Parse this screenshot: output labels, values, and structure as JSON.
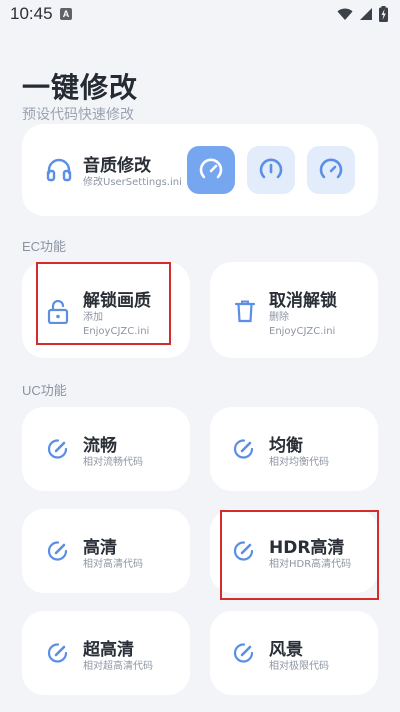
{
  "status_bar": {
    "time": "10:45",
    "notification_badge": "A",
    "icons": [
      "wifi-icon",
      "signal-icon",
      "battery-charging-icon"
    ]
  },
  "header": {
    "title": "一键修改",
    "subtitle": "预设代码快速修改"
  },
  "sound_quality": {
    "title": "音质修改",
    "description": "修改UserSettings.ini",
    "icon": "headphones-icon",
    "options": [
      {
        "icon": "gauge-high-icon",
        "selected": true
      },
      {
        "icon": "gauge-mid-icon",
        "selected": false
      },
      {
        "icon": "gauge-low-icon",
        "selected": false
      }
    ]
  },
  "ec_section": {
    "label": "EC功能",
    "items": [
      {
        "title": "解锁画质",
        "desc_line1": "添加",
        "desc_line2": "EnjoyCJZC.ini",
        "icon": "unlock-icon"
      },
      {
        "title": "取消解锁",
        "desc_line1": "删除",
        "desc_line2": "EnjoyCJZC.ini",
        "icon": "trash-icon"
      }
    ]
  },
  "uc_section": {
    "label": "UC功能",
    "items": [
      {
        "title": "流畅",
        "desc": "相对流畅代码",
        "icon": "edit-icon"
      },
      {
        "title": "均衡",
        "desc": "相对均衡代码",
        "icon": "edit-icon"
      },
      {
        "title": "高清",
        "desc": "相对高清代码",
        "icon": "edit-icon"
      },
      {
        "title": "HDR高清",
        "desc": "相对HDR高清代码",
        "icon": "edit-icon"
      },
      {
        "title": "超高清",
        "desc": "相对超高清代码",
        "icon": "edit-icon"
      },
      {
        "title": "风景",
        "desc": "相对极限代码",
        "icon": "edit-icon"
      }
    ]
  },
  "colors": {
    "accent": "#5b8fe6",
    "accent_light": "#e3ecfb",
    "selected_fill": "#76a6f0",
    "annotation_red": "#d42b2b"
  }
}
